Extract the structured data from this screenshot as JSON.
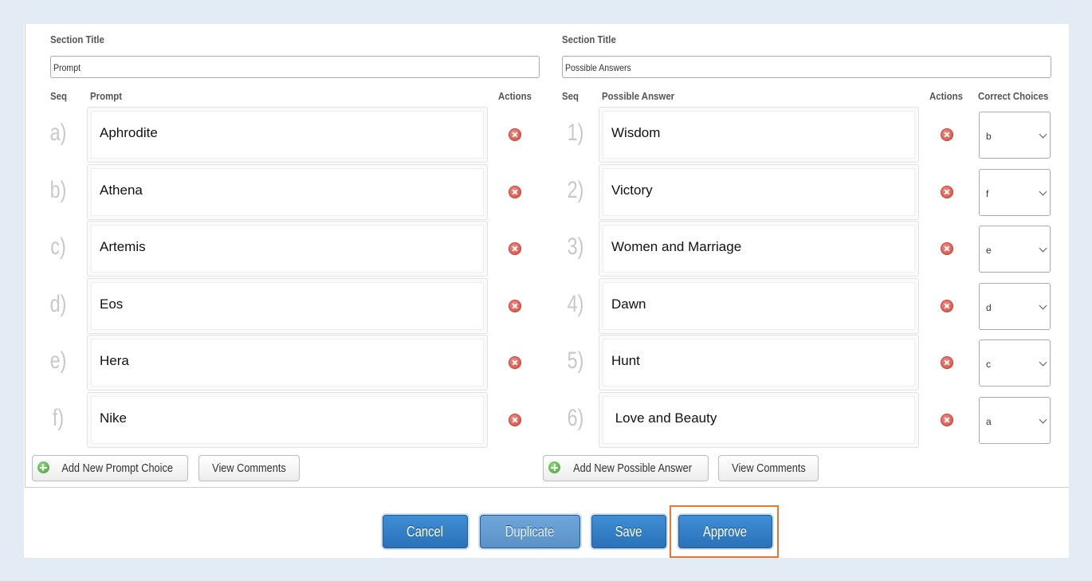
{
  "left": {
    "section_title_label": "Section Title",
    "section_title_value": "Prompt",
    "col_seq": "Seq",
    "col_main": "Prompt",
    "col_actions": "Actions",
    "items": [
      {
        "seq": "a)",
        "text": "Aphrodite"
      },
      {
        "seq": "b)",
        "text": "Athena"
      },
      {
        "seq": "c)",
        "text": "Artemis"
      },
      {
        "seq": "d)",
        "text": "Eos"
      },
      {
        "seq": "e)",
        "text": "Hera"
      },
      {
        "seq": "f)",
        "text": "Nike"
      }
    ],
    "add_button": "Add New Prompt Choice",
    "comments_button": "View Comments"
  },
  "right": {
    "section_title_label": "Section Title",
    "section_title_value": "Possible Answers",
    "col_seq": "Seq",
    "col_main": "Possible Answer",
    "col_actions": "Actions",
    "col_correct": "Correct Choices",
    "items": [
      {
        "seq": "1)",
        "text": "Wisdom",
        "correct": "b"
      },
      {
        "seq": "2)",
        "text": "Victory",
        "correct": "f"
      },
      {
        "seq": "3)",
        "text": "Women and Marriage",
        "correct": "e"
      },
      {
        "seq": "4)",
        "text": "Dawn",
        "correct": "d"
      },
      {
        "seq": "5)",
        "text": "Hunt",
        "correct": "c"
      },
      {
        "seq": "6)",
        "text": " Love and Beauty",
        "correct": "a"
      }
    ],
    "add_button": "Add New Possible Answer",
    "comments_button": "View Comments"
  },
  "footer": {
    "cancel": "Cancel",
    "duplicate": "Duplicate",
    "save": "Save",
    "approve": "Approve"
  },
  "colors": {
    "primary_button": "#2a71b8",
    "focus_ring": "#e8762c",
    "delete_icon": "#d1453b",
    "add_icon": "#3e9e34"
  },
  "icons": {
    "delete": "remove-circle-icon",
    "add": "plus-circle-icon",
    "select": "chevron-down-icon"
  }
}
